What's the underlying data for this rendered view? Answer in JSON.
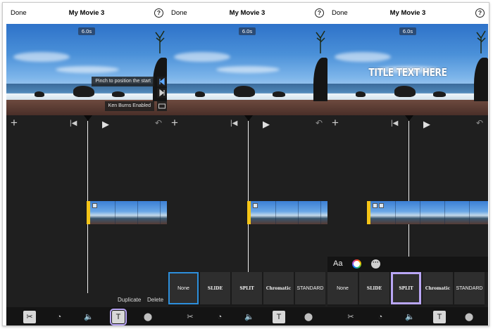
{
  "panels": [
    {
      "nav": {
        "done": "Done",
        "title": "My Movie 3",
        "help": "?"
      },
      "time_badge": "6.0s",
      "tooltip_1": "Pinch to position the start",
      "tooltip_2": "Ken Burns Enabled",
      "actions": {
        "duplicate": "Duplicate",
        "delete": "Delete"
      }
    },
    {
      "nav": {
        "done": "Done",
        "title": "My Movie 3",
        "help": "?"
      },
      "time_badge": "6.0s",
      "transitions": [
        "None",
        "SLIDE",
        "SPLIT",
        "Chromatic",
        "STANDARD"
      ]
    },
    {
      "nav": {
        "done": "Done",
        "title": "My Movie 3",
        "help": "?"
      },
      "time_badge": "6.0s",
      "title_overlay": "TITLE TEXT HERE",
      "font_label": "Aa",
      "transitions": [
        "None",
        "SLIDE",
        "SPLIT",
        "Chromatic",
        "STANDARD"
      ]
    }
  ],
  "icons": {
    "plus": "+",
    "skip_back": "|◀",
    "play": "▶",
    "undo": "↶",
    "scissors": "✂",
    "speed": "◔",
    "volume": "🔈",
    "text": "T",
    "filters": "⬤",
    "more": "···"
  },
  "colors": {
    "accent_selected_purple": "#b9a6f5",
    "accent_selected_blue": "#2d8fdc",
    "clip_handle": "#f5c518",
    "timeline_bg": "#1f1f1f"
  }
}
